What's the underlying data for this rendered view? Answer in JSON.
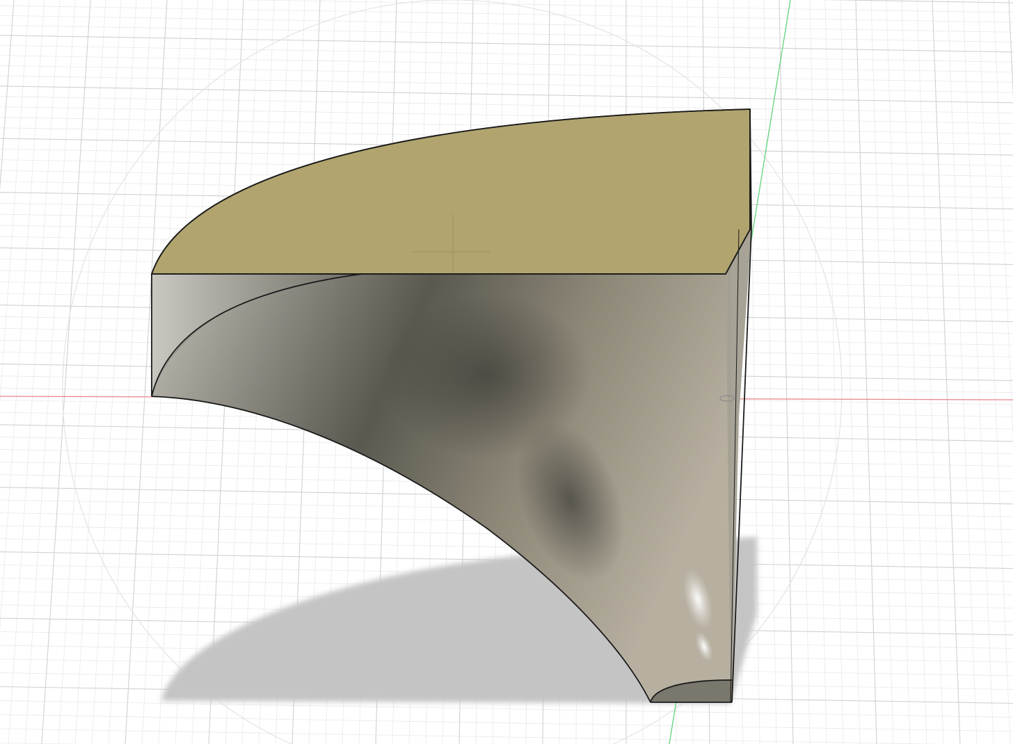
{
  "viewport": {
    "view_mode": "perspective",
    "background_color": "#ffffff",
    "grid": {
      "minor_line_color": "#e9e9e9",
      "major_line_color": "#d0d0d0"
    },
    "axes": {
      "x_axis_color": "#e8898c",
      "z_axis_color": "#5fd37a"
    },
    "model": {
      "top_face_color": "#b1a46e",
      "body_color": "#8f8c82",
      "edge_color": "#1a1a1a",
      "shadow_color": "#c4c4c4"
    }
  }
}
